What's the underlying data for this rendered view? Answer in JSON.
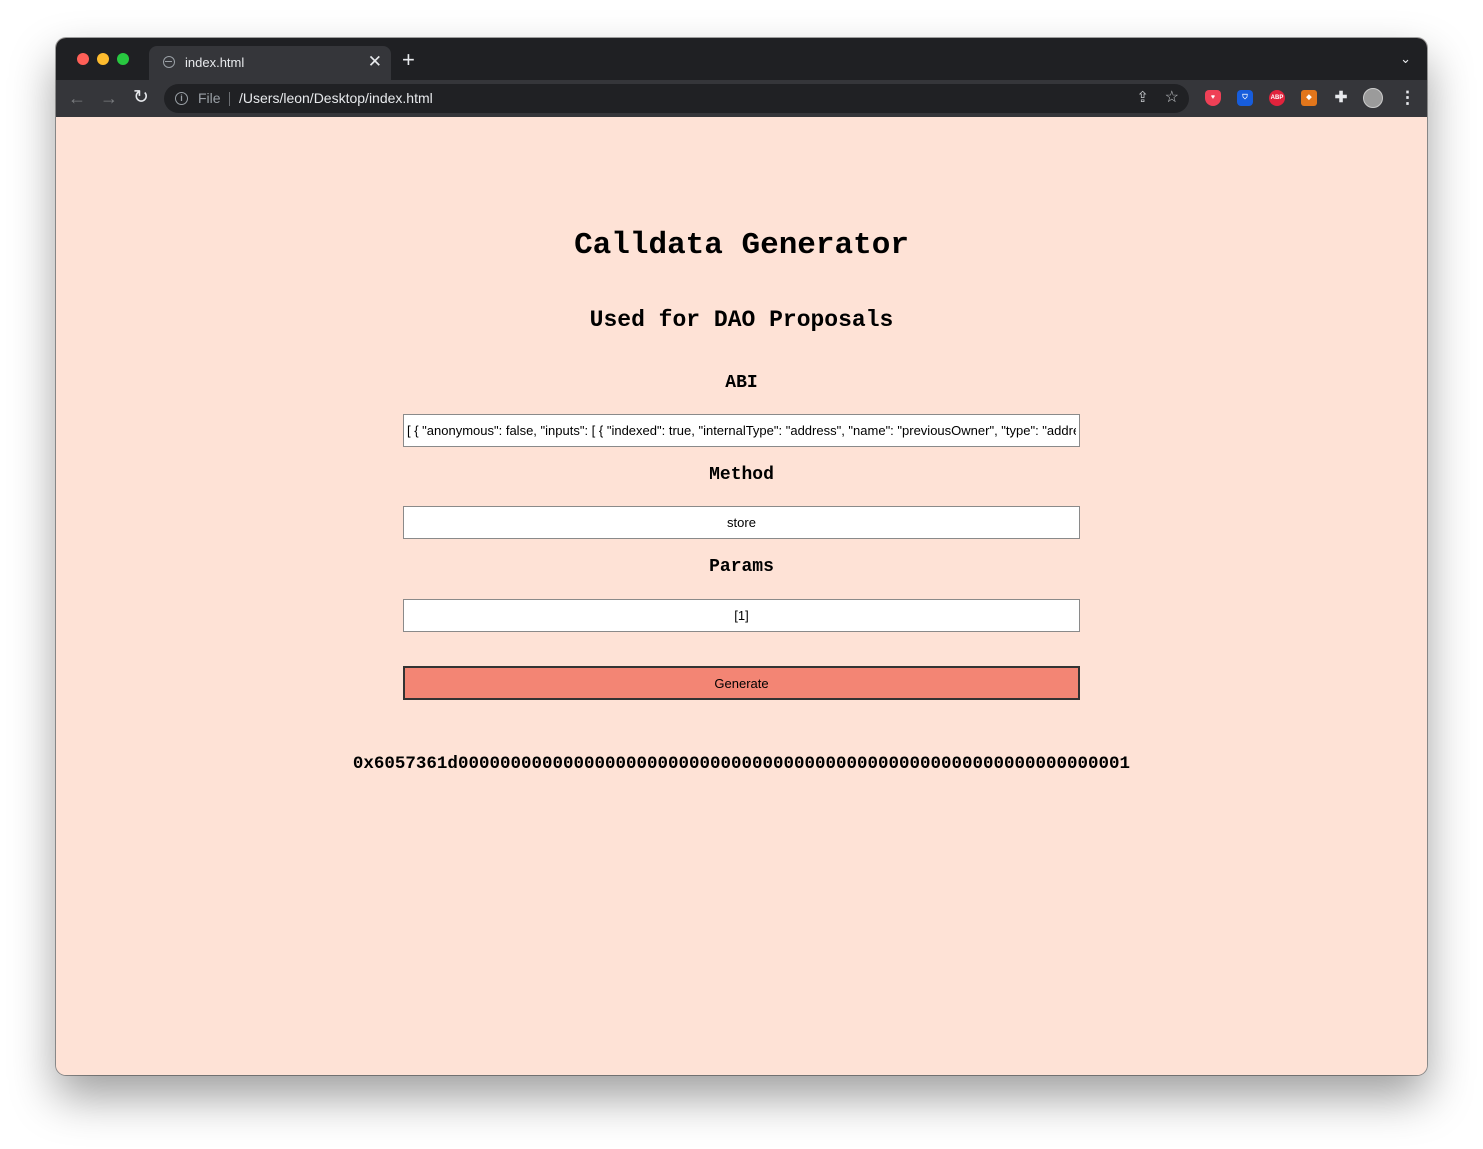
{
  "browser": {
    "tab_title": "index.html",
    "tab_close_glyph": "✕",
    "new_tab_glyph": "+",
    "tab_search_glyph": "⌄",
    "scheme_label": "File",
    "url": "/Users/leon/Desktop/index.html",
    "extensions": [
      "pocket-icon",
      "bitwarden-icon",
      "adblock-plus-icon",
      "metamask-icon",
      "extensions-puzzle-icon",
      "profile-avatar"
    ],
    "abp_label": "ABP"
  },
  "page": {
    "title": "Calldata Generator",
    "subtitle": "Used for DAO Proposals",
    "abi": {
      "label": "ABI",
      "value": "[ { \"anonymous\": false, \"inputs\": [ { \"indexed\": true, \"internalType\": \"address\", \"name\": \"previousOwner\", \"type\": \"address\" } ] } ]"
    },
    "method": {
      "label": "Method",
      "value": "store"
    },
    "params": {
      "label": "Params",
      "value": "[1]"
    },
    "generate_label": "Generate",
    "result": "0x6057361d0000000000000000000000000000000000000000000000000000000000000001"
  }
}
